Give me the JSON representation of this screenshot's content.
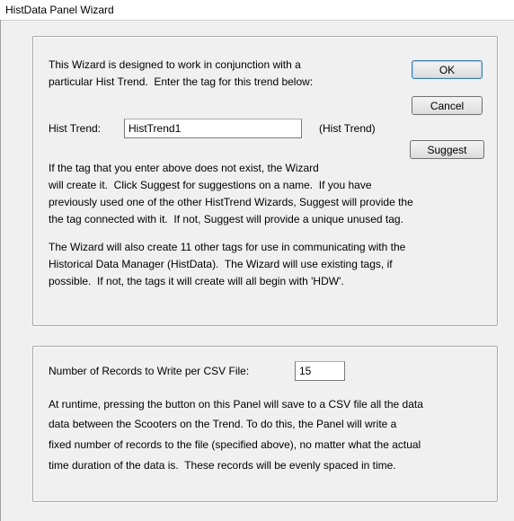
{
  "window": {
    "title": "HistData Panel Wizard"
  },
  "intro": {
    "line1": "This Wizard is designed to work in conjunction with a",
    "line2": "particular Hist Trend.  Enter the tag for this trend below:"
  },
  "hist_trend": {
    "label": "Hist Trend:",
    "value": "HistTrend1",
    "suffix": "(Hist Trend)"
  },
  "buttons": {
    "ok": "OK",
    "cancel": "Cancel",
    "suggest": "Suggest"
  },
  "para1": {
    "line1": "If the tag that you enter above does not exist, the Wizard",
    "line2": "will create it.  Click Suggest for suggestions on a name.  If you have",
    "line3": "previously used one of the other HistTrend Wizards, Suggest will provide the",
    "line4": "the tag connected with it.  If not, Suggest will provide a unique unused tag."
  },
  "para2": {
    "line1": "The Wizard will also create 11 other tags for use in communicating with the",
    "line2": "Historical Data Manager (HistData).  The Wizard will use existing tags, if",
    "line3": "possible.  If not, the tags it will create will all begin with 'HDW'."
  },
  "records": {
    "label": "Number of Records to Write per CSV File:",
    "value": "15"
  },
  "para3": {
    "line1": "At runtime, pressing the button on this Panel will save to a CSV file all the data",
    "line2": "data between the Scooters on the Trend. To do this, the Panel will write a",
    "line3": "fixed number of records to the file (specified above), no matter what the actual",
    "line4": "time duration of the data is.  These records will be evenly spaced in time."
  }
}
